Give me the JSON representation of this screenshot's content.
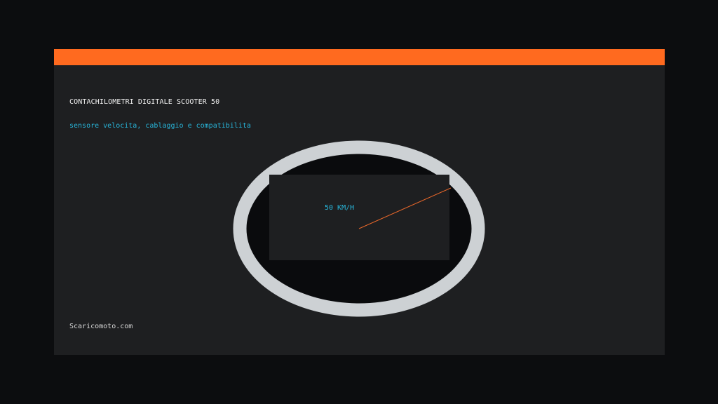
{
  "header": {
    "title": "CONTACHILOMETRI DIGITALE SCOOTER 50",
    "subtitle": "sensore velocita, cablaggio e compatibilita"
  },
  "gauge": {
    "speed_readout": "50 KM/H",
    "needle_color": "#e8672a",
    "ring_color": "#cdd1d4"
  },
  "footer": {
    "site": "Scaricomoto.com"
  },
  "colors": {
    "accent": "#ff6a1f",
    "subtitle": "#28b4d8",
    "panel": "#1e1f21",
    "background": "#0c0d0f"
  }
}
